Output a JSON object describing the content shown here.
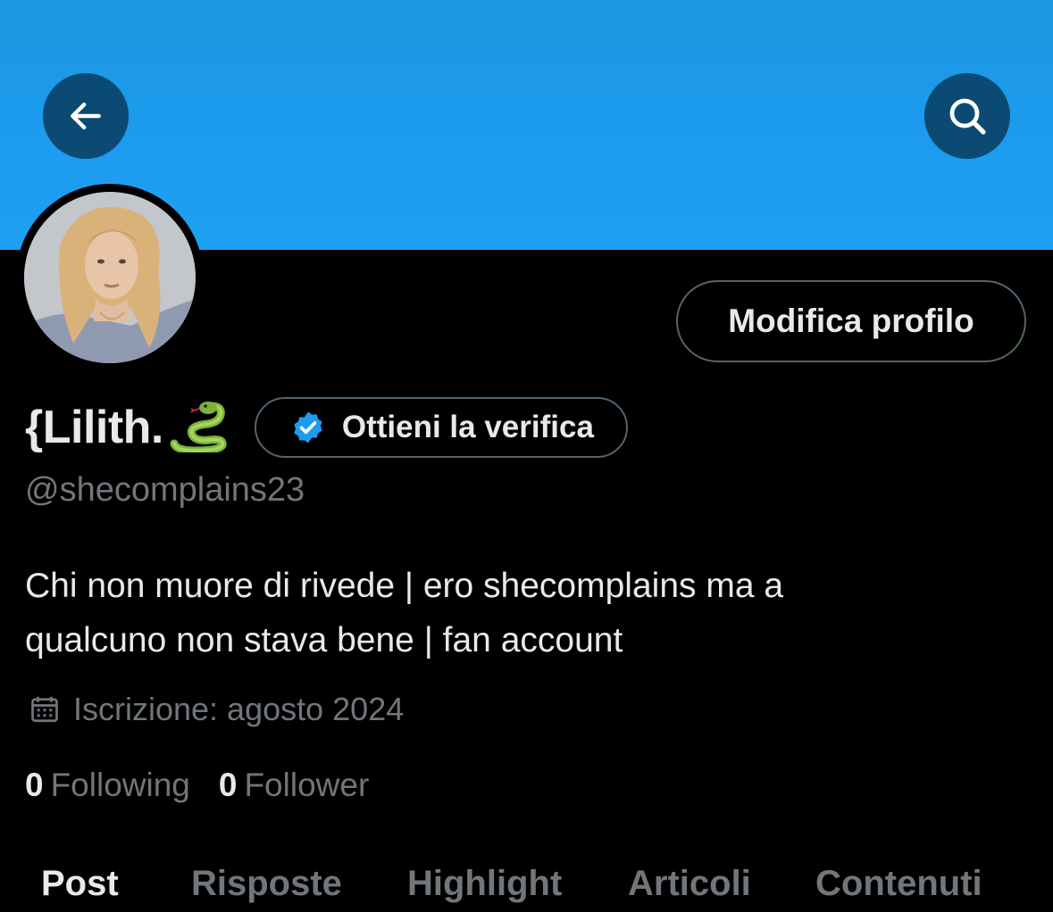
{
  "header": {
    "back_icon": "arrow-left-icon",
    "search_icon": "search-icon",
    "banner_color": "#1d9bf0"
  },
  "profile": {
    "display_name": "{Lilith.",
    "name_emoji": "🐍",
    "handle": "@shecomplains23",
    "edit_button": "Modifica profilo",
    "verify_button": "Ottieni la verifica",
    "bio_line1": "Chi non muore di rivede | ero shecomplains ma a",
    "bio_line2": "qualcuno non stava bene | fan account",
    "joined": "Iscrizione: agosto 2024",
    "following_count": "0",
    "following_label": "Following",
    "follower_count": "0",
    "follower_label": "Follower"
  },
  "tabs": [
    {
      "label": "Post",
      "active": true
    },
    {
      "label": "Risposte",
      "active": false
    },
    {
      "label": "Highlight",
      "active": false
    },
    {
      "label": "Articoli",
      "active": false
    },
    {
      "label": "Contenuti",
      "active": false
    }
  ],
  "colors": {
    "accent": "#1d9bf0",
    "verified_badge": "#1d9bf0",
    "text_primary": "#e7e9ea",
    "text_secondary": "#71767b",
    "border": "#536471"
  }
}
